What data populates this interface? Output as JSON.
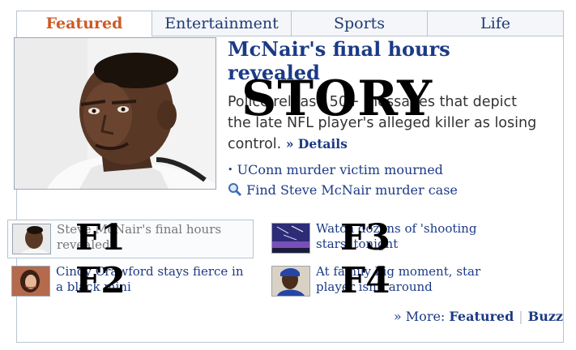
{
  "tabs": [
    "Featured",
    "Entertainment",
    "Sports",
    "Life"
  ],
  "story": {
    "headline": "McNair's final hours revealed",
    "summary": "Police release 50+ messages that depict the late NFL player's alleged killer as losing control.",
    "details_link": "» Details",
    "overlay_label": "STORY",
    "bullets": [
      {
        "icon": "bullet",
        "text": "UConn murder victim mourned"
      },
      {
        "icon": "search-icon",
        "text": "Find Steve McNair murder case"
      }
    ]
  },
  "features": [
    {
      "text": "Steve McNair's final hours revealed",
      "label": "F1"
    },
    {
      "text": "Cindy Crawford stays fierce in a black mini",
      "label": "F2"
    },
    {
      "text": "Watch dozens of 'shooting stars' tonight",
      "label": "F3"
    },
    {
      "text": "At family big moment, star player isn't around",
      "label": "F4"
    }
  ],
  "more": {
    "label": "» More:",
    "links": [
      "Featured",
      "Buzz"
    ]
  }
}
